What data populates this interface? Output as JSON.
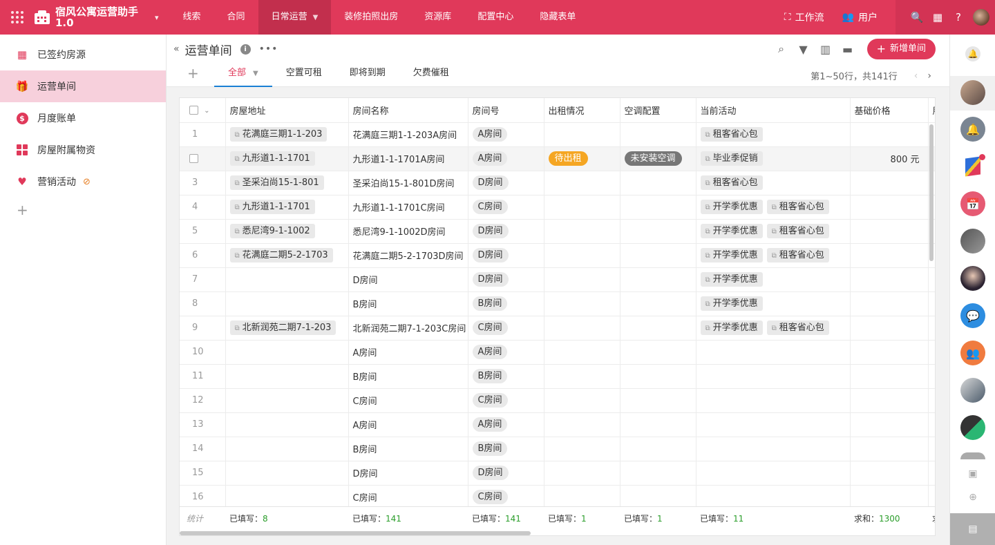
{
  "app": {
    "title": "宿风公寓运营助手 1.0"
  },
  "nav": [
    {
      "label": "线索"
    },
    {
      "label": "合同"
    },
    {
      "label": "日常运营"
    },
    {
      "label": "装修拍照出房"
    },
    {
      "label": "资源库"
    },
    {
      "label": "配置中心"
    },
    {
      "label": "隐藏表单"
    }
  ],
  "top_right": {
    "workflow": "工作流",
    "users": "用户"
  },
  "sidebar": {
    "items": [
      {
        "label": "已签约房源",
        "icon": "building-icon"
      },
      {
        "label": "运营单间",
        "icon": "gift-icon"
      },
      {
        "label": "月度账单",
        "icon": "dollar-icon"
      },
      {
        "label": "房屋附属物资",
        "icon": "grid-icon"
      },
      {
        "label": "营销活动",
        "icon": "heart-icon"
      }
    ]
  },
  "page": {
    "title": "运营单间"
  },
  "toolbar": {
    "add_label": "新增单间"
  },
  "tabs": [
    {
      "label": "全部"
    },
    {
      "label": "空置可租"
    },
    {
      "label": "即将到期"
    },
    {
      "label": "欠费催租"
    }
  ],
  "pager": {
    "text": "第1~50行，共141行"
  },
  "table": {
    "columns": [
      "房屋地址",
      "房间名称",
      "房间号",
      "出租情况",
      "空调配置",
      "当前活动",
      "基础价格",
      "朋"
    ],
    "rows": [
      {
        "n": "1",
        "address": "花满庭三期1-1-203",
        "name": "花满庭三期1-1-203A房间",
        "room": "A房间",
        "rent": "",
        "ac": "",
        "acts": [
          "租客省心包"
        ],
        "price": ""
      },
      {
        "n": "",
        "address": "九形道1-1-1701",
        "name": "九形道1-1-1701A房间",
        "room": "A房间",
        "rent": "待出租",
        "ac": "未安装空调",
        "acts": [
          "毕业季促销"
        ],
        "price": "800 元"
      },
      {
        "n": "3",
        "address": "圣采泊尚15-1-801",
        "name": "圣采泊尚15-1-801D房间",
        "room": "D房间",
        "rent": "",
        "ac": "",
        "acts": [
          "租客省心包"
        ],
        "price": ""
      },
      {
        "n": "4",
        "address": "九形道1-1-1701",
        "name": "九形道1-1-1701C房间",
        "room": "C房间",
        "rent": "",
        "ac": "",
        "acts": [
          "开学季优惠",
          "租客省心包"
        ],
        "price": ""
      },
      {
        "n": "5",
        "address": "悉尼湾9-1-1002",
        "name": "悉尼湾9-1-1002D房间",
        "room": "D房间",
        "rent": "",
        "ac": "",
        "acts": [
          "开学季优惠",
          "租客省心包"
        ],
        "price": ""
      },
      {
        "n": "6",
        "address": "花满庭二期5-2-1703",
        "name": "花满庭二期5-2-1703D房间",
        "room": "D房间",
        "rent": "",
        "ac": "",
        "acts": [
          "开学季优惠",
          "租客省心包"
        ],
        "price": ""
      },
      {
        "n": "7",
        "address": "",
        "name": "D房间",
        "room": "D房间",
        "rent": "",
        "ac": "",
        "acts": [
          "开学季优惠"
        ],
        "price": ""
      },
      {
        "n": "8",
        "address": "",
        "name": "B房间",
        "room": "B房间",
        "rent": "",
        "ac": "",
        "acts": [
          "开学季优惠"
        ],
        "price": ""
      },
      {
        "n": "9",
        "address": "北新润苑二期7-1-203",
        "name": "北新润苑二期7-1-203C房间",
        "room": "C房间",
        "rent": "",
        "ac": "",
        "acts": [
          "开学季优惠",
          "租客省心包"
        ],
        "price": ""
      },
      {
        "n": "10",
        "address": "",
        "name": "A房间",
        "room": "A房间",
        "rent": "",
        "ac": "",
        "acts": [],
        "price": ""
      },
      {
        "n": "11",
        "address": "",
        "name": "B房间",
        "room": "B房间",
        "rent": "",
        "ac": "",
        "acts": [],
        "price": ""
      },
      {
        "n": "12",
        "address": "",
        "name": "C房间",
        "room": "C房间",
        "rent": "",
        "ac": "",
        "acts": [],
        "price": ""
      },
      {
        "n": "13",
        "address": "",
        "name": "A房间",
        "room": "A房间",
        "rent": "",
        "ac": "",
        "acts": [],
        "price": ""
      },
      {
        "n": "14",
        "address": "",
        "name": "B房间",
        "room": "B房间",
        "rent": "",
        "ac": "",
        "acts": [],
        "price": ""
      },
      {
        "n": "15",
        "address": "",
        "name": "D房间",
        "room": "D房间",
        "rent": "",
        "ac": "",
        "acts": [],
        "price": ""
      },
      {
        "n": "16",
        "address": "",
        "name": "C房间",
        "room": "C房间",
        "rent": "",
        "ac": "",
        "acts": [],
        "price": ""
      }
    ],
    "stats": {
      "label": "统计",
      "cells": [
        {
          "prefix": "已填写：",
          "value": "8"
        },
        {
          "prefix": "已填写：",
          "value": "141"
        },
        {
          "prefix": "已填写：",
          "value": "141"
        },
        {
          "prefix": "已填写：",
          "value": "1"
        },
        {
          "prefix": "已填写：",
          "value": "1"
        },
        {
          "prefix": "已填写：",
          "value": "11"
        },
        {
          "prefix": "求和：",
          "value": "1300"
        },
        {
          "prefix": "求",
          "value": ""
        }
      ]
    }
  },
  "colors": {
    "brand": "#e0395a",
    "status_wait": "#f5a623",
    "status_ac": "#777777",
    "stat_value": "#2a9d2a"
  }
}
